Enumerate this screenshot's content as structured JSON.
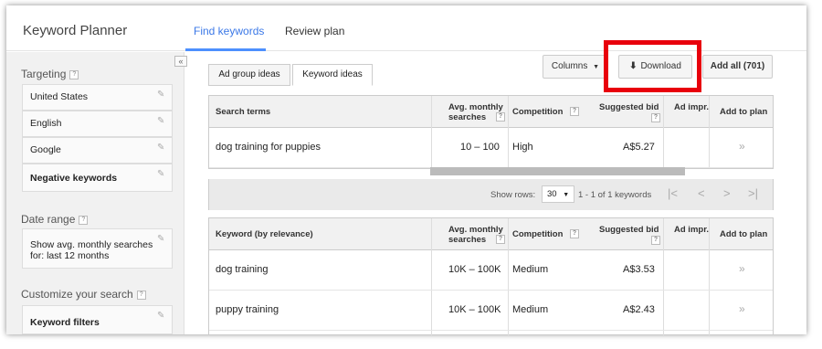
{
  "header": {
    "title": "Keyword Planner",
    "tabs": [
      {
        "label": "Find keywords",
        "active": true
      },
      {
        "label": "Review plan",
        "active": false
      }
    ],
    "accent": "#4d90fe"
  },
  "sidebar": {
    "collapse_glyph": "«",
    "targeting_label": "Targeting",
    "targeting_items": [
      "United States",
      "English",
      "Google"
    ],
    "negative_keywords": "Negative keywords",
    "date_range_label": "Date range",
    "date_range_value": "Show avg. monthly searches for: last 12 months",
    "customize_label": "Customize your search",
    "keyword_filters": "Keyword filters",
    "help_glyph": "?"
  },
  "toolbar": {
    "tabs": [
      "Ad group ideas",
      "Keyword ideas"
    ],
    "active_tab": "Keyword ideas",
    "columns_label": "Columns",
    "download_label": "Download",
    "add_all_label": "Add all (701)",
    "highlight_color": "#e8000c"
  },
  "search_table": {
    "headers": {
      "term": "Search terms",
      "avg_line1": "Avg. monthly",
      "avg_line2": "searches",
      "competition": "Competition",
      "bid": "Suggested bid",
      "impr": "Ad impr.",
      "add": "Add to plan"
    },
    "rows": [
      {
        "term": "dog training for puppies",
        "avg": "10 – 100",
        "competition": "High",
        "bid": "A$5.27"
      }
    ]
  },
  "pager": {
    "show_rows_label": "Show rows:",
    "rows_value": "30",
    "range": "1 - 1 of 1 keywords"
  },
  "keyword_table": {
    "headers": {
      "term": "Keyword (by relevance)",
      "avg_line1": "Avg. monthly",
      "avg_line2": "searches",
      "competition": "Competition",
      "bid": "Suggested bid",
      "impr": "Ad impr.",
      "add": "Add to plan"
    },
    "rows": [
      {
        "term": "dog training",
        "avg": "10K – 100K",
        "competition": "Medium",
        "bid": "A$3.53"
      },
      {
        "term": "puppy training",
        "avg": "10K – 100K",
        "competition": "Medium",
        "bid": "A$2.43"
      }
    ]
  },
  "icons": {
    "pencil": "pencil-icon",
    "add": "add-to-plan-icon",
    "download": "download-icon",
    "dropdown": "chevron-down-icon"
  }
}
